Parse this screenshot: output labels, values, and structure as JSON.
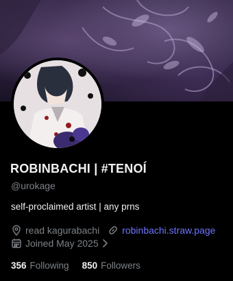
{
  "profile": {
    "display_name": "ROBINBACHI | #TENOÍ",
    "handle": "@urokage",
    "bio": "self-proclaimed artist | any prns",
    "location": "read kagurabachi",
    "website": "robinbachi.straw.page",
    "joined": "Joined May 2025",
    "following_count": "356",
    "following_label": "Following",
    "followers_count": "850",
    "followers_label": "Followers"
  },
  "colors": {
    "background": "#000000",
    "link": "#6e74ff",
    "muted": "#7d8287",
    "banner_purple": "#3a2c4d"
  },
  "icons": {
    "location": "location-pin-icon",
    "website": "link-icon",
    "joined": "calendar-icon",
    "joined_chevron": "chevron-right-icon"
  }
}
